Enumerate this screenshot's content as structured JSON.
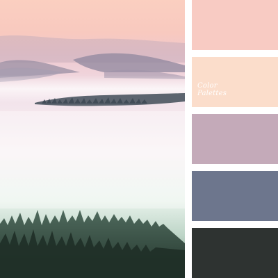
{
  "watermark": {
    "line1": "Color",
    "line2": "Palettes"
  },
  "palette": [
    {
      "name": "pink",
      "hex": "#F8CBC3"
    },
    {
      "name": "peach",
      "hex": "#FBDDCB"
    },
    {
      "name": "mauve",
      "hex": "#C4AAB9"
    },
    {
      "name": "slate-blue",
      "hex": "#6D768D"
    },
    {
      "name": "charcoal",
      "hex": "#2E3331"
    }
  ]
}
